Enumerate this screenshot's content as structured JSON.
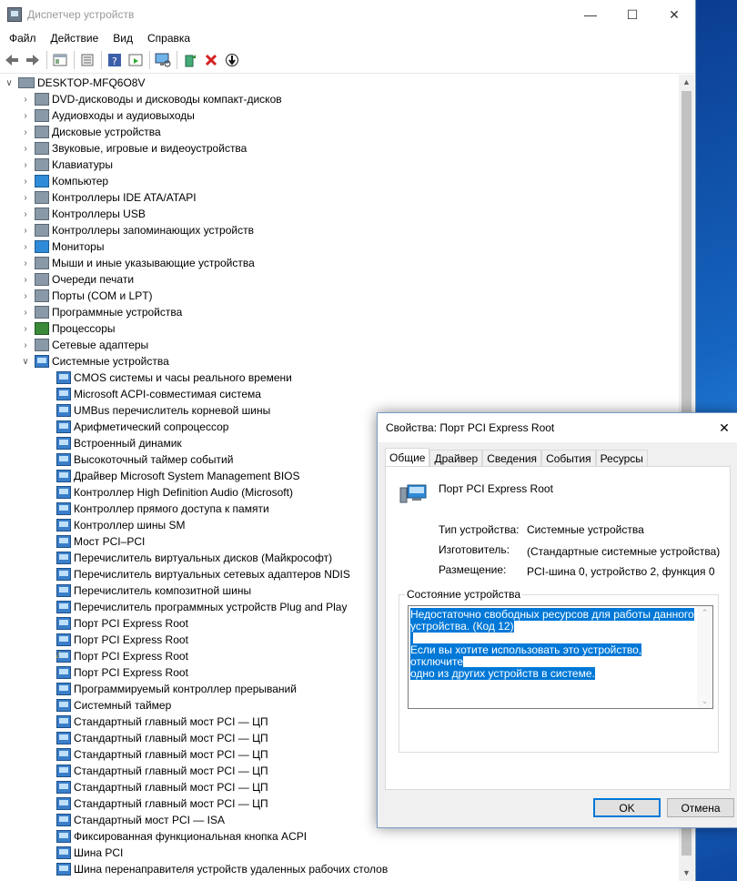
{
  "window": {
    "title": "Диспетчер устройств"
  },
  "menu": [
    "Файл",
    "Действие",
    "Вид",
    "Справка"
  ],
  "tree": {
    "root": "DESKTOP-MFQ6O8V",
    "categories": [
      "DVD-дисководы и дисководы компакт-дисков",
      "Аудиовходы и аудиовыходы",
      "Дисковые устройства",
      "Звуковые, игровые и видеоустройства",
      "Клавиатуры",
      "Компьютер",
      "Контроллеры IDE ATA/ATAPI",
      "Контроллеры USB",
      "Контроллеры запоминающих устройств",
      "Мониторы",
      "Мыши и иные указывающие устройства",
      "Очереди печати",
      "Порты (COM и LPT)",
      "Программные устройства",
      "Процессоры",
      "Сетевые адаптеры"
    ],
    "expanded_category": "Системные устройства",
    "system_devices": [
      "CMOS системы и часы реального времени",
      "Microsoft ACPI-совместимая система",
      "UMBus перечислитель корневой шины",
      "Арифметический сопроцессор",
      "Встроенный динамик",
      "Высокоточный таймер событий",
      "Драйвер Microsoft System Management BIOS",
      "Контроллер High Definition Audio (Microsoft)",
      "Контроллер прямого доступа к памяти",
      "Контроллер шины SM",
      "Мост PCI–PCI",
      "Перечислитель виртуальных дисков (Майкрософт)",
      "Перечислитель виртуальных сетевых адаптеров NDIS",
      "Перечислитель композитной шины",
      "Перечислитель программных устройств Plug and Play",
      "Порт PCI Express Root",
      "Порт PCI Express Root",
      "Порт PCI Express Root",
      "Порт PCI Express Root",
      "Программируемый контроллер прерываний",
      "Системный таймер",
      "Стандартный главный мост PCI — ЦП",
      "Стандартный главный мост PCI — ЦП",
      "Стандартный главный мост PCI — ЦП",
      "Стандартный главный мост PCI — ЦП",
      "Стандартный главный мост PCI — ЦП",
      "Стандартный главный мост PCI — ЦП",
      "Стандартный мост PCI — ISA",
      "Фиксированная функциональная кнопка ACPI",
      "Шина PCI",
      "Шина перенаправителя устройств удаленных рабочих столов"
    ]
  },
  "dialog": {
    "title": "Свойства: Порт PCI Express Root",
    "tabs": [
      "Общие",
      "Драйвер",
      "Сведения",
      "События",
      "Ресурсы"
    ],
    "device_name": "Порт PCI Express Root",
    "type_label": "Тип устройства:",
    "type_value": "Системные устройства",
    "manufacturer_label": "Изготовитель:",
    "manufacturer_value": "(Стандартные системные устройства)",
    "location_label": "Размещение:",
    "location_value": "PCI-шина 0, устройство 2, функция 0",
    "status_group": "Состояние устройства",
    "status_line1": "Недостаточно свободных ресурсов для работы данного",
    "status_line2": "устройства. (Код 12)",
    "status_line3": "Если вы хотите использовать это устройство, отключите",
    "status_line4": "одно из других устройств в системе.",
    "ok": "OK",
    "cancel": "Отмена"
  }
}
